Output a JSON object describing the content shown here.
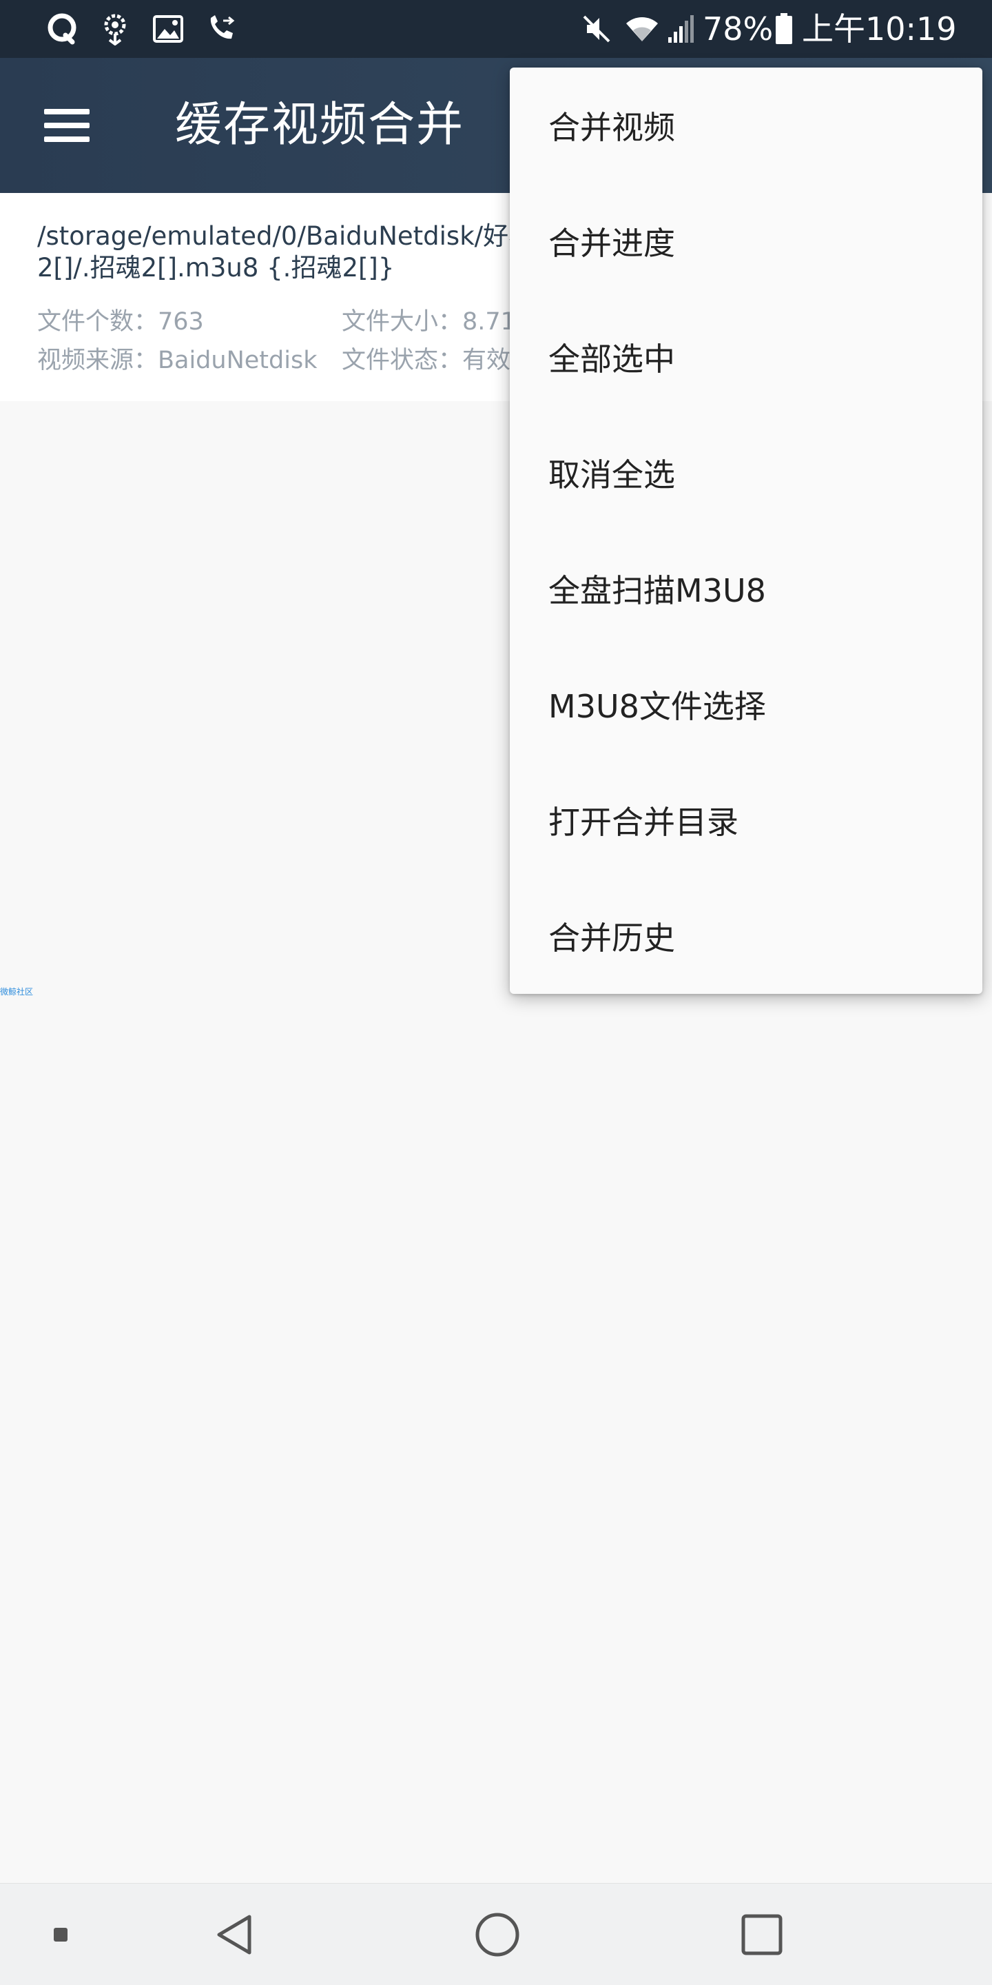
{
  "status_bar": {
    "battery": "78%",
    "time": "上午10:19",
    "left_icons": [
      "qq-icon",
      "flower-icon",
      "gallery-icon",
      "call-forward-icon"
    ],
    "right_icons": [
      "mute-icon",
      "wifi-icon",
      "signal-icon",
      "battery-icon"
    ]
  },
  "app_bar": {
    "title": "缓存视频合并",
    "menu_icon": "hamburger-icon"
  },
  "file_item": {
    "path": "/storage/emulated/0/BaiduNetdisk/好看\n2[]/.招魂2[].m3u8 {.招魂2[]}",
    "count_label": "文件个数：763",
    "size_label": "文件大小：8.71",
    "source_label": "视频来源：BaiduNetdisk",
    "status_label": "文件状态：有效"
  },
  "tiny_link": "微鲸社区",
  "popup_menu": {
    "items": [
      {
        "label": "合并视频"
      },
      {
        "label": "合并进度"
      },
      {
        "label": "全部选中"
      },
      {
        "label": "取消全选"
      },
      {
        "label": "全盘扫描M3U8"
      },
      {
        "label": "M3U8文件选择"
      },
      {
        "label": "打开合并目录"
      },
      {
        "label": "合并历史"
      }
    ]
  },
  "nav_bar": {
    "icons": [
      "menu-dot-icon",
      "back-icon",
      "home-icon",
      "recents-icon"
    ]
  },
  "colors": {
    "status_bar": "#1e2a38",
    "app_bar": "#2f4358",
    "accent_link": "#2f8ddc"
  }
}
